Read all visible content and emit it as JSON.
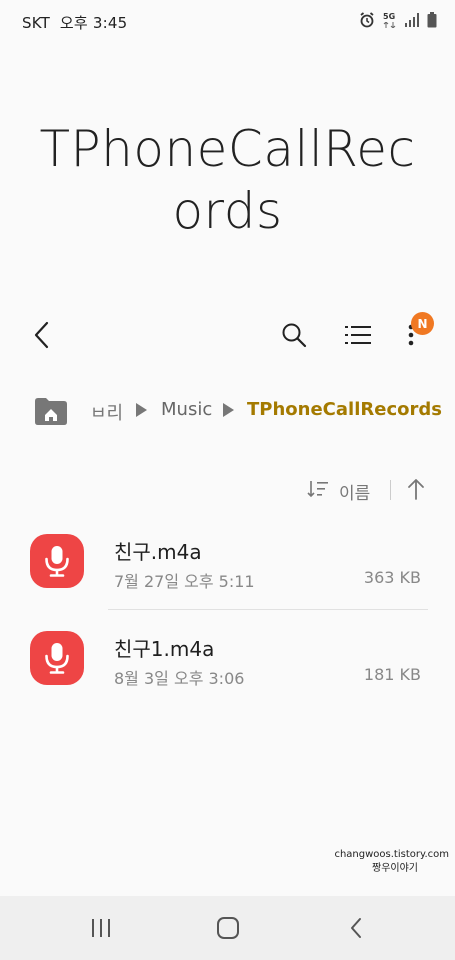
{
  "status_bar": {
    "carrier": "SKT",
    "time": "오후 3:45",
    "network": "5G",
    "icons": [
      "alarm-icon",
      "network-5g-icon",
      "signal-icon",
      "battery-icon"
    ]
  },
  "title": "TPhoneCallRecords",
  "toolbar": {
    "icons": [
      "back-icon",
      "search-icon",
      "list-view-icon",
      "more-icon"
    ],
    "notification_badge": "N"
  },
  "breadcrumb": {
    "items": [
      "ㅂ리",
      "Music",
      "TPhoneCallRecords"
    ],
    "current_color": "#a47a00"
  },
  "sort": {
    "label": "이름",
    "direction": "ascending"
  },
  "files": [
    {
      "name": "친구.m4a",
      "date": "7월 27일 오후 5:11",
      "size": "363 KB",
      "icon": "mic-icon"
    },
    {
      "name": "친구1.m4a",
      "date": "8월 3일 오후 3:06",
      "size": "181 KB",
      "icon": "mic-icon"
    }
  ],
  "watermark": {
    "line1": "changwoos.tistory.com",
    "line2": "짱우이야기"
  },
  "nav_bar": {
    "icons": [
      "recent-apps-icon",
      "home-icon",
      "back-icon"
    ]
  },
  "colors": {
    "accent_badge": "#f07822",
    "file_icon_bg": "#ee4545"
  }
}
